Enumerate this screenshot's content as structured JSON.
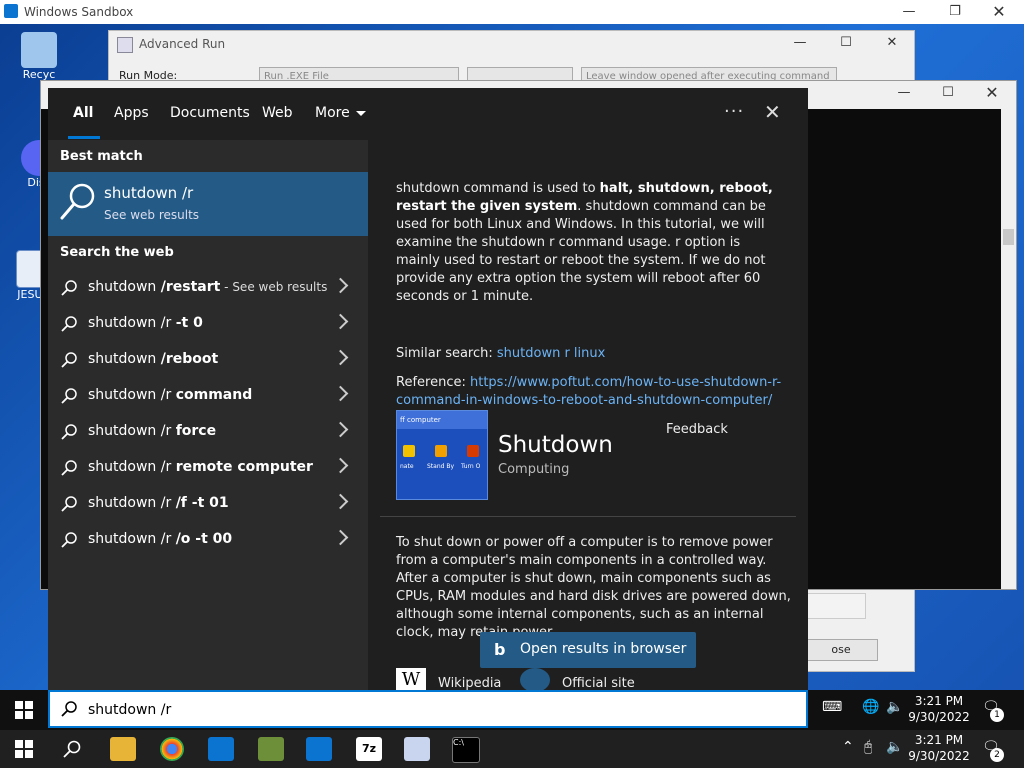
{
  "sandbox": {
    "title": "Windows Sandbox"
  },
  "desktop_icons": [
    {
      "label": "Recyc"
    },
    {
      "label": "Disc"
    },
    {
      "label": "JESUIS"
    }
  ],
  "advanced_run": {
    "title": "Advanced Run",
    "run_mode_label": "Run Mode:",
    "run_mode_value": "Run .EXE File",
    "option_label": "Leave window opened after executing command",
    "close_label": "ose"
  },
  "search": {
    "tabs": [
      "All",
      "Apps",
      "Documents",
      "Web",
      "More"
    ],
    "more_caret": "chevron-down",
    "best_match_header": "Best match",
    "best_match": {
      "title": "shutdown /r",
      "subtitle": "See web results"
    },
    "web_header": "Search the web",
    "results": [
      {
        "prefix": "shutdown ",
        "bold": "/restart",
        "suffix": " - See web results"
      },
      {
        "prefix": "shutdown /r ",
        "bold": "-t 0",
        "suffix": ""
      },
      {
        "prefix": "shutdown ",
        "bold": "/reboot",
        "suffix": ""
      },
      {
        "prefix": "shutdown /r ",
        "bold": "command",
        "suffix": ""
      },
      {
        "prefix": "shutdown /r ",
        "bold": "force",
        "suffix": ""
      },
      {
        "prefix": "shutdown /r ",
        "bold": "remote computer",
        "suffix": ""
      },
      {
        "prefix": "shutdown /r ",
        "bold": "/f -t 01",
        "suffix": ""
      },
      {
        "prefix": "shutdown /r ",
        "bold": "/o -t 00",
        "suffix": ""
      }
    ],
    "query": "shutdown /r"
  },
  "preview": {
    "desc_part1": "shutdown command is used to ",
    "desc_bold": "halt, shutdown, reboot, restart the given system",
    "desc_part2": ". shutdown command can be used for both Linux and Windows. In this tutorial, we will examine the shutdown r command usage. r option is mainly used to restart or reboot the system. If we do not provide any extra option the system will reboot after 60 seconds or 1 minute.",
    "similar_label": "Similar search: ",
    "similar_link": "shutdown r linux",
    "reference_label": "Reference: ",
    "reference_link": "https://www.poftut.com/how-to-use-shutdown-r-command-in-windows-to-reboot-and-shutdown-computer/",
    "feedback": "Feedback",
    "entity_title": "Shutdown",
    "entity_subtitle": "Computing",
    "thumb_bar_text": "ff computer",
    "thumb_btn_labels": [
      "nate",
      "Stand By",
      "Turn O"
    ],
    "paragraph": "To shut down or power off a computer is to remove power from a computer's main components in a controlled way. After a computer is shut down, main components such as CPUs, RAM modules and hard disk drives are powered down, although some internal components, such as an internal clock, may retain power.",
    "open_button": "Open results in browser",
    "source_wikipedia": "Wikipedia",
    "source_official": "Official site"
  },
  "taskbar_top": {
    "time": "3:21 PM",
    "date": "9/30/2022",
    "notification_count": "1"
  },
  "taskbar_bottom": {
    "time": "3:21 PM",
    "date": "9/30/2022",
    "notification_count": "2",
    "cmd_label": "C:\\"
  },
  "colors": {
    "accent": "#0078d4",
    "selected": "#235b86",
    "link": "#6bb3f5"
  }
}
